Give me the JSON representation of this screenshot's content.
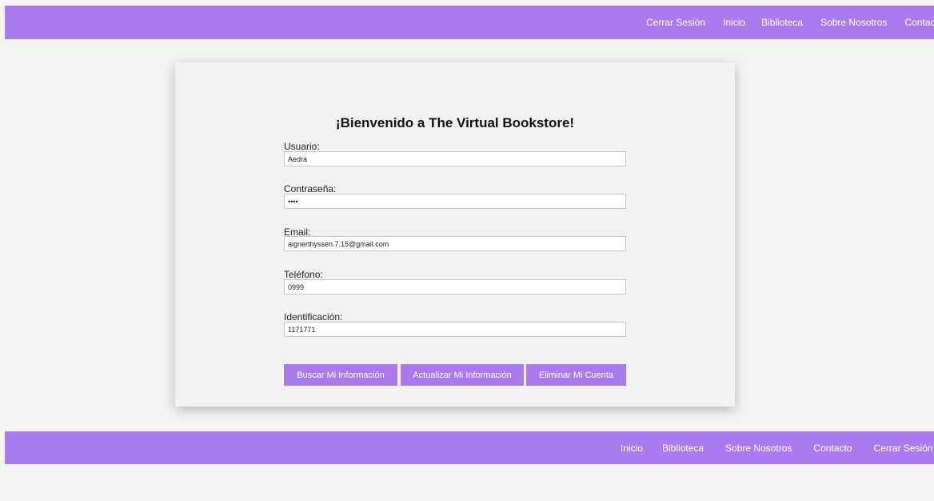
{
  "header": {
    "nav": [
      "Cerrar Sesión",
      "Inicio",
      "Biblioteca",
      "Sobre Nosotros",
      "Contacto"
    ]
  },
  "form": {
    "title": "¡Bienvenido a The Virtual Bookstore!",
    "fields": [
      {
        "label": "Usuario:",
        "value": "Aedra"
      },
      {
        "label": "Contraseña:",
        "value": "••••"
      },
      {
        "label": "Email:",
        "value": "aignerthyssen.7.15@gmail.com"
      },
      {
        "label": "Teléfono:",
        "value": "0999"
      },
      {
        "label": "Identificación:",
        "value": "1171771"
      }
    ],
    "buttons": {
      "search": "Buscar Mi Información",
      "update": "Actualizar Mi Información",
      "delete": "Eliminar Mi Cuenta"
    }
  },
  "footer": {
    "nav": [
      "Inicio",
      "Biblioteca",
      "Sobre Nosotros",
      "Contacto",
      "Cerrar Sesión"
    ]
  },
  "colors": {
    "accent": "#a97bef",
    "page_bg": "#f4f4f4",
    "card_bg": "#f2f2f2"
  }
}
